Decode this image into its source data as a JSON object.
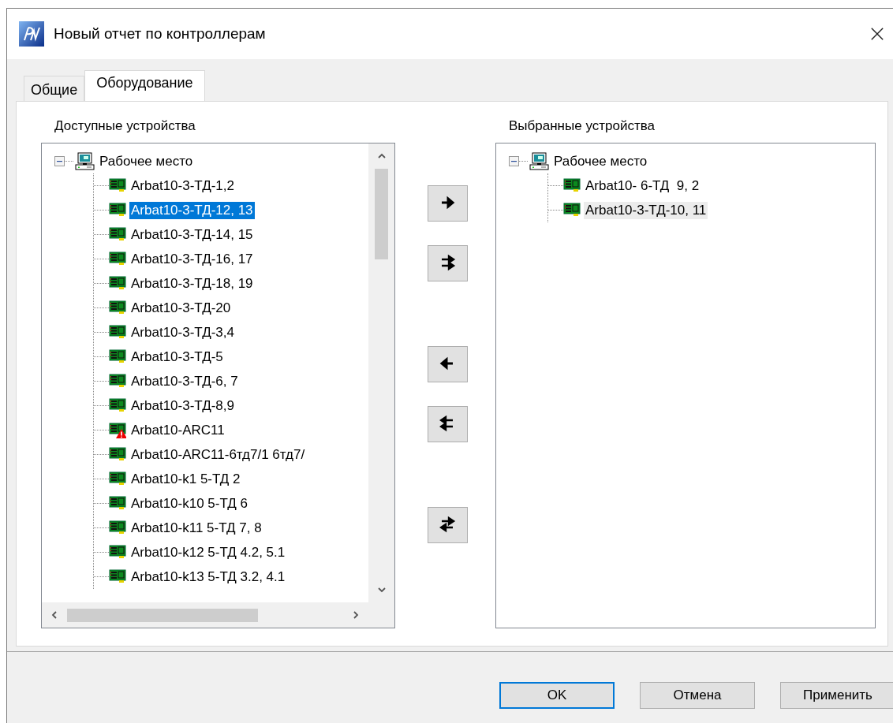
{
  "window": {
    "title": "Новый отчет по контроллерам"
  },
  "tabs": [
    {
      "label": "Общие",
      "selected": false
    },
    {
      "label": "Оборудование",
      "selected": true
    }
  ],
  "available": {
    "label": "Доступные устройства",
    "focused": true,
    "tree": [
      {
        "label": "Рабочее место",
        "kind": "workstation",
        "expanded": true,
        "selected": false,
        "children": [
          {
            "label": "Arbat10-3-ТД-1,2",
            "kind": "controller",
            "selected": false
          },
          {
            "label": "Arbat10-3-ТД-12, 13",
            "kind": "controller",
            "selected": true
          },
          {
            "label": "Arbat10-3-ТД-14, 15",
            "kind": "controller",
            "selected": false
          },
          {
            "label": "Arbat10-3-ТД-16, 17",
            "kind": "controller",
            "selected": false
          },
          {
            "label": "Arbat10-3-ТД-18, 19",
            "kind": "controller",
            "selected": false
          },
          {
            "label": "Arbat10-3-ТД-20",
            "kind": "controller",
            "selected": false
          },
          {
            "label": "Arbat10-3-ТД-3,4",
            "kind": "controller",
            "selected": false
          },
          {
            "label": "Arbat10-3-ТД-5",
            "kind": "controller",
            "selected": false
          },
          {
            "label": "Arbat10-3-ТД-6, 7",
            "kind": "controller",
            "selected": false
          },
          {
            "label": "Arbat10-3-ТД-8,9",
            "kind": "controller",
            "selected": false
          },
          {
            "label": "Arbat10-ARC11",
            "kind": "controller-warning",
            "selected": false
          },
          {
            "label": "Arbat10-ARC11-6тд7/1 6тд7/",
            "kind": "controller",
            "selected": false
          },
          {
            "label": "Arbat10-k1 5-ТД 2",
            "kind": "controller",
            "selected": false
          },
          {
            "label": "Arbat10-k10 5-ТД 6",
            "kind": "controller",
            "selected": false
          },
          {
            "label": "Arbat10-k11 5-ТД 7, 8",
            "kind": "controller",
            "selected": false
          },
          {
            "label": "Arbat10-k12 5-ТД 4.2, 5.1",
            "kind": "controller",
            "selected": false
          },
          {
            "label": "Arbat10-k13 5-ТД 3.2, 4.1",
            "kind": "controller",
            "selected": false
          }
        ]
      }
    ]
  },
  "move_buttons": [
    {
      "kind": "add"
    },
    {
      "kind": "add-all"
    },
    {
      "kind": "remove"
    },
    {
      "kind": "remove-all"
    },
    {
      "kind": "swap"
    }
  ],
  "chosen": {
    "label": "Выбранные устройства",
    "focused": false,
    "tree": [
      {
        "label": "Рабочее место",
        "kind": "workstation",
        "expanded": true,
        "selected": false,
        "children": [
          {
            "label": "Arbat10- 6-ТД  9, 2",
            "kind": "controller",
            "selected": false
          },
          {
            "label": "Arbat10-3-ТД-10, 11",
            "kind": "controller",
            "selected": true
          }
        ]
      }
    ]
  },
  "buttons": [
    {
      "label": "OK",
      "default": true
    },
    {
      "label": "Отмена",
      "default": false
    },
    {
      "label": "Применить",
      "default": false
    }
  ]
}
